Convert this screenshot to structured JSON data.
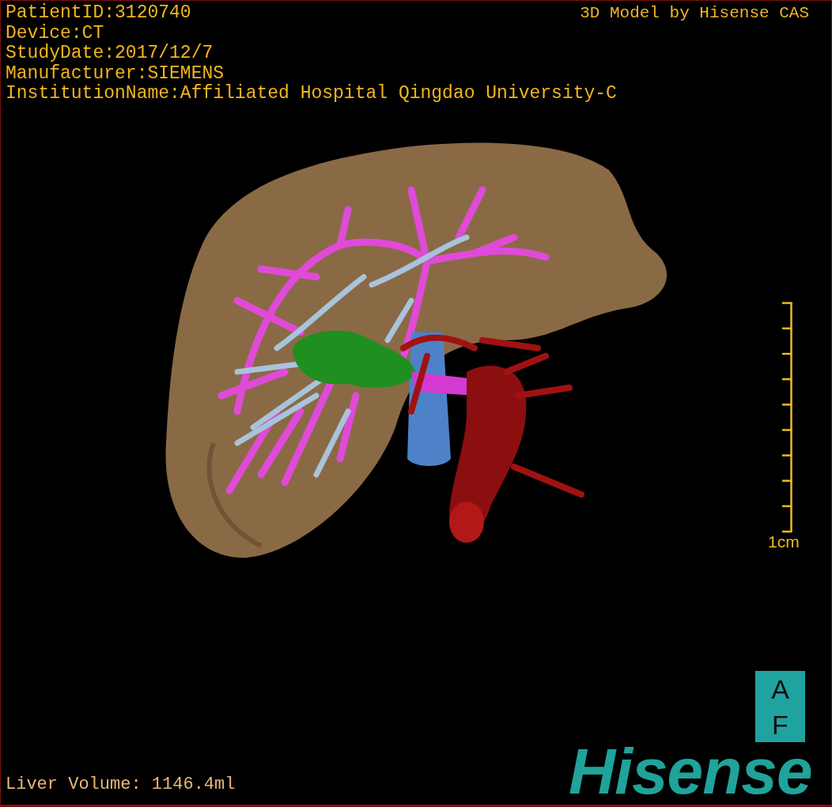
{
  "study_info": [
    "PatientID:3120740",
    "Device:CT",
    "StudyDate:2017/12/7",
    "Manufacturer:SIEMENS",
    "InstitutionName:Affiliated Hospital Qingdao University-C"
  ],
  "model_credit": "3D Model by Hisense CAS",
  "scale_bar": {
    "label": "1cm"
  },
  "orientation_marker": [
    "A",
    "F"
  ],
  "logo": "Hisense",
  "liver_volume": "Liver Volume: 1146.4ml"
}
